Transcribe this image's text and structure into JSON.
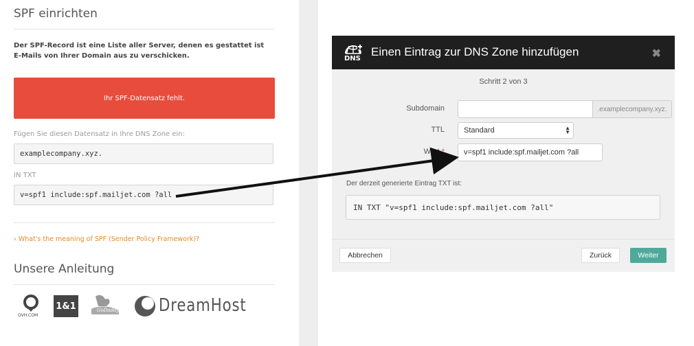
{
  "left": {
    "title": "SPF einrichten",
    "description": "Der SPF-Record ist eine Liste aller Server, denen es gestattet ist E-Mails von Ihrer Domain aus zu verschicken.",
    "alert": "Ihr SPF-Datensatz fehlt.",
    "instruction": "Fügen Sie diesen Datensatz in Ihre DNS Zone ein:",
    "domain_value": "examplecompany.xyz.",
    "record_type": "IN TXT",
    "record_value": "v=spf1 include:spf.mailjet.com ?all",
    "help_link": "What's the meaning of SPF (Sender Policy Framework)?",
    "guide_title": "Unsere Anleitung",
    "logos": {
      "ovh": "OVH.COM",
      "oneandone": "1&1",
      "godaddy": "GoDaddy",
      "dreamhost": "DreamHost"
    }
  },
  "modal": {
    "icon_text": "DNS",
    "title": "Einen Eintrag zur DNS Zone hinzufügen",
    "close": "✖",
    "step": "Schritt 2 von 3",
    "fields": {
      "subdomain_label": "Subdomain",
      "subdomain_value": "",
      "subdomain_suffix": ".examplecompany.xyz.",
      "ttl_label": "TTL",
      "ttl_value": "Standard",
      "value_label": "Wert",
      "value_required": "*",
      "value_value": "v=spf1 include:spf.mailjet.com ?all"
    },
    "generated_label": "Der derzeit generierte Eintrag TXT ist:",
    "generated_value": "IN TXT \"v=spf1 include:spf.mailjet.com ?all\"",
    "buttons": {
      "cancel": "Abbrechen",
      "back": "Zurück",
      "next": "Weiter"
    }
  },
  "colors": {
    "alert": "#e74c3c",
    "link": "#e08a27",
    "primary_button": "#4fa99a",
    "modal_header": "#1f1f1f",
    "required": "#e74c3c"
  }
}
